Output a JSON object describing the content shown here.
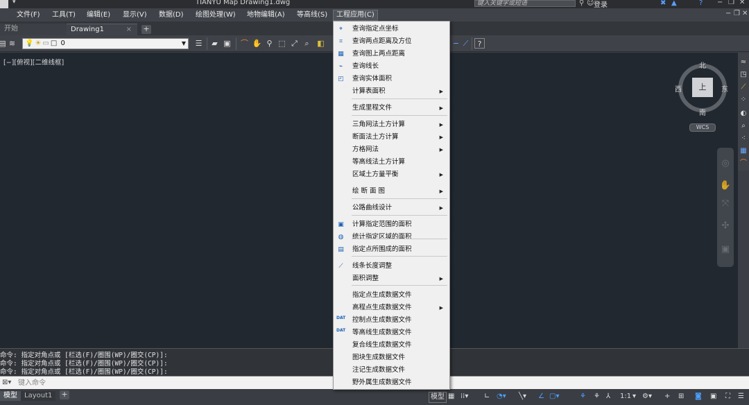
{
  "titlebar": {
    "title": "TIANYU Map    Drawing1.dwg",
    "search_placeholder": "键入关键字或短语",
    "login": "登录",
    "help": "?",
    "minimize": "−",
    "restore": "❐",
    "close": "✕"
  },
  "menu": {
    "items": [
      "文件(F)",
      "工具(T)",
      "编辑(E)",
      "显示(V)",
      "数据(D)",
      "绘图处理(W)",
      "地物编辑(A)",
      "等高线(S)",
      "工程应用(C)"
    ],
    "active_index": 8
  },
  "tabs": {
    "start": "开始",
    "drawing": "Drawing1",
    "close_glyph": "×",
    "add_glyph": "+"
  },
  "toolbar": {
    "layer_value": "0"
  },
  "view": {
    "label": "[−][俯视][二维线框]",
    "cube_face": "上",
    "north": "北",
    "south": "南",
    "east": "东",
    "west": "西",
    "wcs": "WCS"
  },
  "command": {
    "history": [
      "命令: 指定对角点或 [栏选(F)/圈围(WP)/圈交(CP)]:",
      "命令: 指定对角点或 [栏选(F)/圈围(WP)/圈交(CP)]:",
      "命令: 指定对角点或 [栏选(F)/圈围(WP)/圈交(CP)]:"
    ],
    "input_placeholder": "键入命令"
  },
  "statusbar": {
    "model_tab": "模型",
    "layout_tab": "Layout1",
    "add_glyph": "+",
    "model_label": "模型",
    "scale": "1:1"
  },
  "dropdown": {
    "items": [
      {
        "label": "查询指定点坐标",
        "icon": "query-point-icon",
        "glyph": "⌖",
        "submenu": false
      },
      {
        "label": "查询两点距离及方位",
        "icon": "query-distance-icon",
        "glyph": "⌗",
        "submenu": false
      },
      {
        "label": "查询图上两点距离",
        "icon": "query-map-distance-icon",
        "glyph": "▦",
        "submenu": false
      },
      {
        "label": "查询线长",
        "icon": "query-line-length-icon",
        "glyph": "⌁",
        "submenu": false
      },
      {
        "label": "查询实体面积",
        "icon": "query-entity-area-icon",
        "glyph": "◰",
        "submenu": false
      },
      {
        "label": "计算表面积",
        "icon": "",
        "glyph": "",
        "submenu": true
      },
      {
        "label": "生成里程文件",
        "icon": "",
        "glyph": "",
        "submenu": true
      },
      {
        "label": "三角网法土方计算",
        "icon": "",
        "glyph": "",
        "submenu": true
      },
      {
        "label": "断面法土方计算",
        "icon": "",
        "glyph": "",
        "submenu": true
      },
      {
        "label": "方格网法",
        "icon": "",
        "glyph": "",
        "submenu": true
      },
      {
        "label": "等高线法土方计算",
        "icon": "",
        "glyph": "",
        "submenu": false
      },
      {
        "label": "区域土方量平衡",
        "icon": "",
        "glyph": "",
        "submenu": true
      },
      {
        "label": "绘 断 面 图",
        "icon": "",
        "glyph": "",
        "submenu": true
      },
      {
        "label": "公路曲线设计",
        "icon": "",
        "glyph": "",
        "submenu": true
      },
      {
        "label": "计算指定范围的面积",
        "icon": "calc-range-area-icon",
        "glyph": "▣",
        "submenu": false
      },
      {
        "label": "统计指定区域的面积",
        "icon": "stat-region-area-icon",
        "glyph": "◍",
        "submenu": false
      },
      {
        "label": "指定点所围成的面积",
        "icon": "point-enclosed-area-icon",
        "glyph": "▤",
        "submenu": false
      },
      {
        "label": "线条长度调整",
        "icon": "line-length-adjust-icon",
        "glyph": "⟋",
        "submenu": false
      },
      {
        "label": "面积调整",
        "icon": "",
        "glyph": "",
        "submenu": true
      },
      {
        "label": "指定点生成数据文件",
        "icon": "",
        "glyph": "",
        "submenu": false
      },
      {
        "label": "高程点生成数据文件",
        "icon": "",
        "glyph": "",
        "submenu": true
      },
      {
        "label": "控制点生成数据文件",
        "icon": "dat-file-icon",
        "glyph": "DAT",
        "submenu": false
      },
      {
        "label": "等高线生成数据文件",
        "icon": "dat-file-icon",
        "glyph": "DAT",
        "submenu": false
      },
      {
        "label": "复合线生成数据文件",
        "icon": "",
        "glyph": "",
        "submenu": false
      },
      {
        "label": "图块生成数据文件",
        "icon": "",
        "glyph": "",
        "submenu": false
      },
      {
        "label": "注记生成数据文件",
        "icon": "",
        "glyph": "",
        "submenu": false
      },
      {
        "label": "野外属生成数据文件",
        "icon": "",
        "glyph": "",
        "submenu": false
      }
    ]
  }
}
